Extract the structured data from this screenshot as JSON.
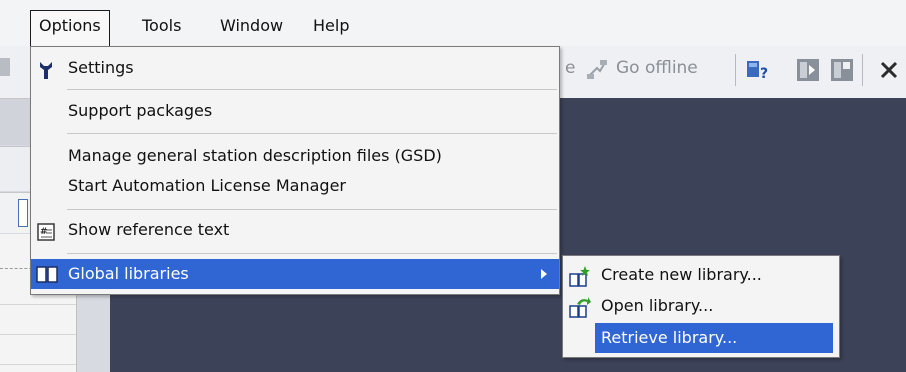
{
  "menubar": {
    "items": [
      {
        "label": "Options",
        "state": "open"
      },
      {
        "label": "Tools"
      },
      {
        "label": "Window"
      },
      {
        "label": "Help"
      }
    ]
  },
  "toolbar": {
    "partial_label": "e",
    "go_offline_label": "Go offline"
  },
  "options_menu": {
    "items": [
      {
        "label": "Settings",
        "icon": "wrench-icon"
      },
      {
        "label": "Support packages"
      },
      {
        "label": "Manage general station description files (GSD)"
      },
      {
        "label": "Start Automation License Manager"
      },
      {
        "label": "Show reference text",
        "icon": "reference-text-icon"
      },
      {
        "label": "Global libraries",
        "icon": "book-icon",
        "highlighted": true,
        "has_submenu": true
      }
    ]
  },
  "global_libraries_submenu": {
    "items": [
      {
        "label": "Create new library...",
        "icon": "create-library-icon"
      },
      {
        "label": "Open library...",
        "icon": "open-library-icon"
      },
      {
        "label": "Retrieve library...",
        "highlighted": true
      }
    ]
  },
  "colors": {
    "highlight": "#2f66d3",
    "workspace_dark": "#3c4258",
    "menu_bg": "#f4f4f4"
  }
}
